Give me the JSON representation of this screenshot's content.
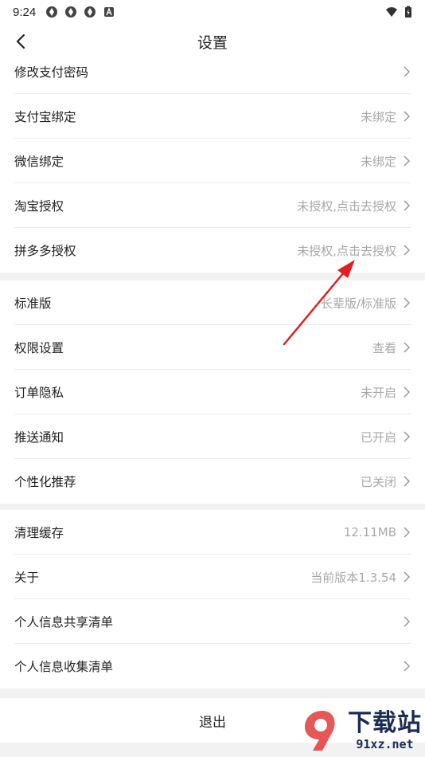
{
  "status_bar": {
    "time": "9:24"
  },
  "header": {
    "title": "设置",
    "back_icon": "chevron-left-icon"
  },
  "groups": [
    {
      "rows": [
        {
          "label": "修改支付密码",
          "value": ""
        },
        {
          "label": "支付宝绑定",
          "value": "未绑定"
        },
        {
          "label": "微信绑定",
          "value": "未绑定"
        },
        {
          "label": "淘宝授权",
          "value": "未授权,点击去授权"
        },
        {
          "label": "拼多多授权",
          "value": "未授权,点击去授权"
        }
      ]
    },
    {
      "rows": [
        {
          "label": "标准版",
          "value": "长辈版/标准版"
        },
        {
          "label": "权限设置",
          "value": "查看"
        },
        {
          "label": "订单隐私",
          "value": "未开启"
        },
        {
          "label": "推送通知",
          "value": "已开启"
        },
        {
          "label": "个性化推荐",
          "value": "已关闭"
        }
      ]
    },
    {
      "rows": [
        {
          "label": "清理缓存",
          "value": "12.11MB"
        },
        {
          "label": "关于",
          "value": "当前版本1.3.54"
        },
        {
          "label": "个人信息共享清单",
          "value": ""
        },
        {
          "label": "个人信息收集清单",
          "value": ""
        }
      ]
    }
  ],
  "logout": {
    "label": "退出"
  },
  "watermark": {
    "text": "下载站",
    "url": "91xz.net"
  },
  "colors": {
    "annotation_arrow": "#e02020",
    "value_text": "#a8a8a8",
    "background": "#f2f2f2"
  }
}
